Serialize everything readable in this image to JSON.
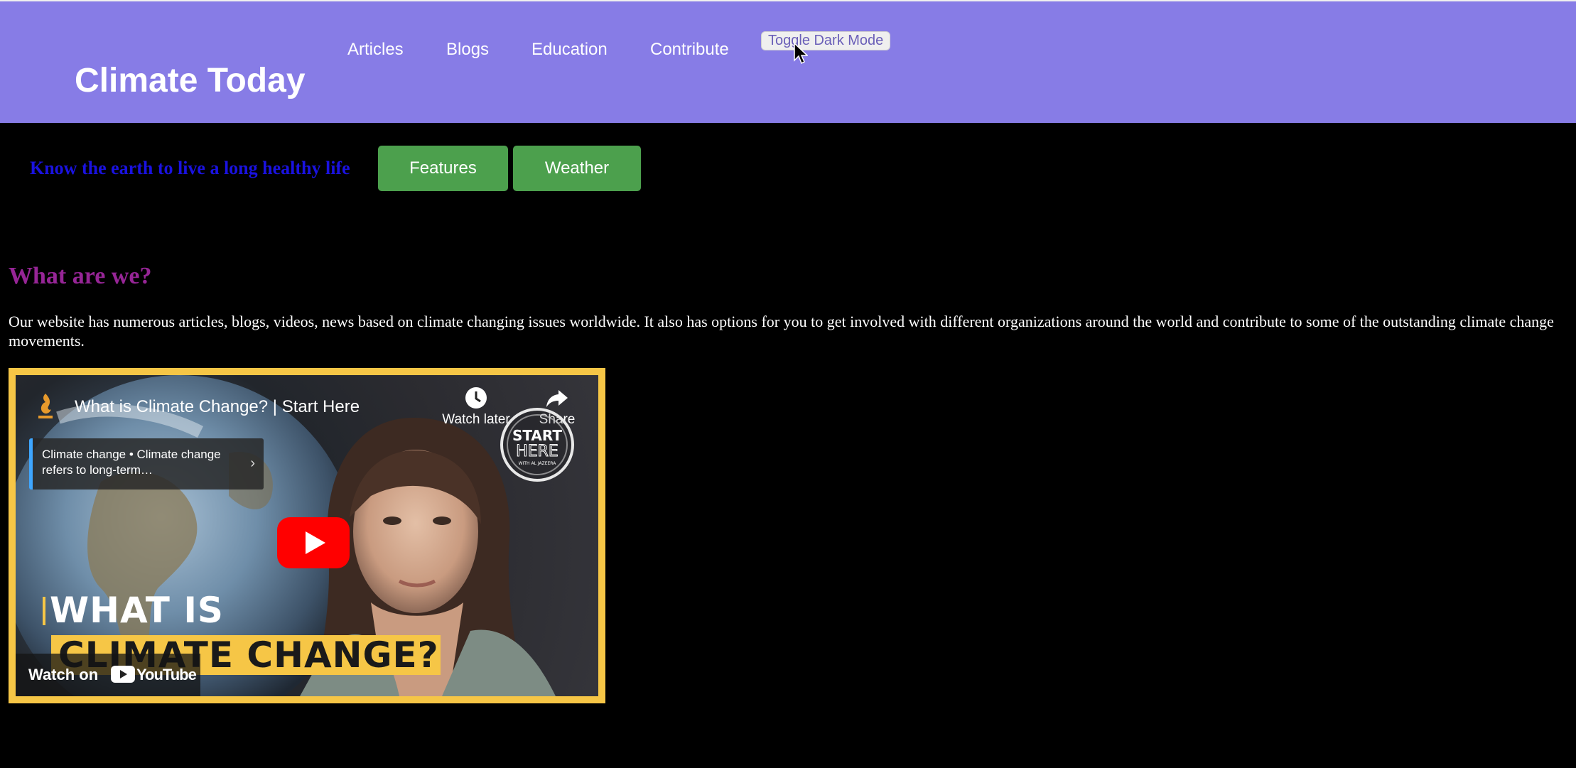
{
  "header": {
    "brand": "Climate Today",
    "nav": {
      "articles": "Articles",
      "blogs": "Blogs",
      "education": "Education",
      "contribute": "Contribute"
    },
    "toggle_label": "Toggle Dark Mode",
    "background_color": "#877CE6"
  },
  "hero": {
    "tagline": "Know the earth to live a long healthy life",
    "features_label": "Features",
    "weather_label": "Weather",
    "button_color": "#4CA04D"
  },
  "about": {
    "title": "What are we?",
    "text": "Our website has numerous articles, blogs, videos, news based on climate changing issues worldwide. It also has options for you to get involved with different organizations around the world and contribute to some of the outstanding climate change movements."
  },
  "video": {
    "title": "What is Climate Change? | Start Here",
    "watch_later": "Watch later",
    "share": "Share",
    "info_card": "Climate change • Climate change refers to long-term…",
    "start_here_line1": "START",
    "start_here_line2": "HERE",
    "start_here_line3": "WITH AL JAZEERA",
    "caption_line1": "WHAT IS",
    "caption_line2": "CLIMATE CHANGE?",
    "watch_on": "Watch on",
    "youtube": "YouTube",
    "border_color": "#f6c646"
  },
  "icons": [
    "cursor-icon",
    "channel-logo-icon",
    "clock-icon",
    "share-arrow-icon",
    "chevron-right-icon",
    "play-icon",
    "youtube-logo-icon"
  ]
}
